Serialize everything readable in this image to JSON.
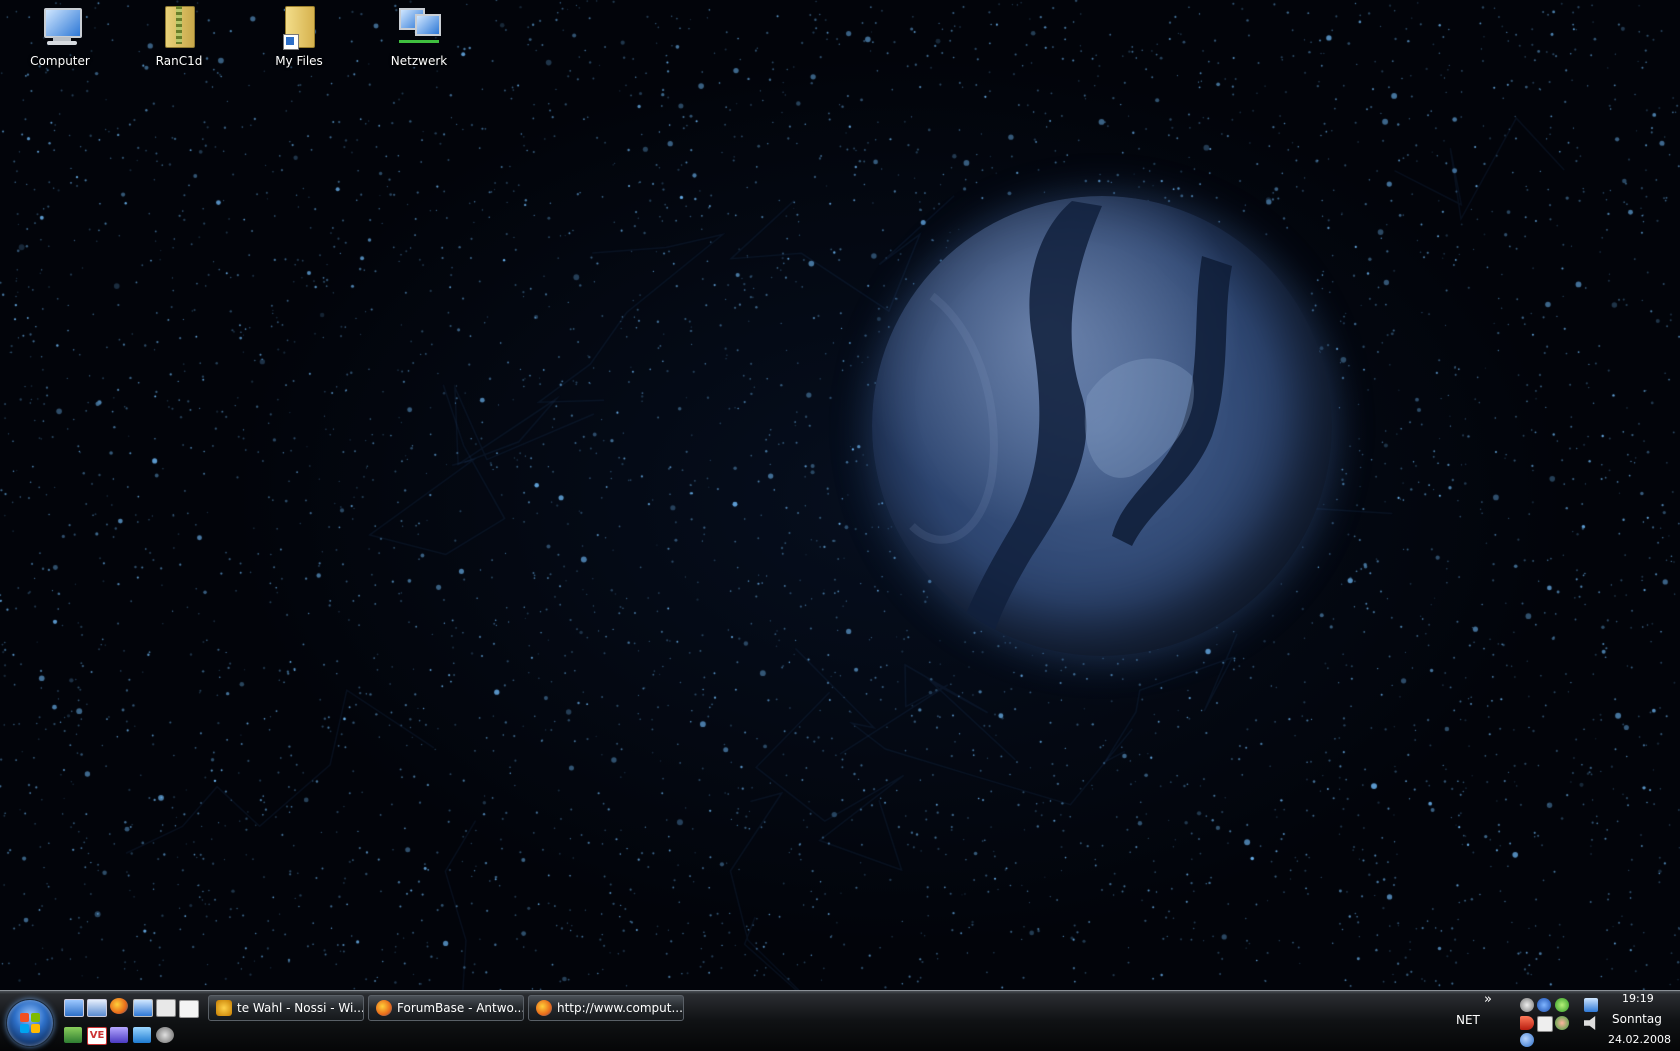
{
  "desktop": {
    "icons": [
      {
        "label": "Computer",
        "icon": "computer-icon"
      },
      {
        "label": "RanC1d",
        "icon": "zip-folder-icon"
      },
      {
        "label": "My Files",
        "icon": "folder-shortcut-icon"
      },
      {
        "label": "Netzwerk",
        "icon": "network-icon"
      }
    ],
    "wallpaper": "starfield-globe"
  },
  "taskbar": {
    "start_icon": "windows-start-orb-icon",
    "quick_launch_row1": [
      "show-desktop-icon",
      "switch-windows-icon",
      "firefox-icon",
      "computer-small-icon",
      "mail-icon",
      "email-icon"
    ],
    "quick_launch_row2": [
      "app-triangle-icon",
      "ve-icon",
      "app-purple-icon",
      "app-blue-icon",
      "steam-icon"
    ],
    "tasks": [
      {
        "label": "te Wahl - Nossi - Wi...",
        "icon": "winamp-icon"
      },
      {
        "label": "ForumBase - Antwo...",
        "icon": "firefox-icon"
      },
      {
        "label": "http://www.comput...",
        "icon": "firefox-icon"
      }
    ],
    "tray": {
      "expand": "»",
      "net_label": "NET",
      "time": "19:19",
      "day": "Sonntag",
      "date": "24.02.2008"
    }
  },
  "colors": {
    "accent": "#2d6fc7",
    "taskbar": "#101214",
    "globe": "#46618f"
  }
}
